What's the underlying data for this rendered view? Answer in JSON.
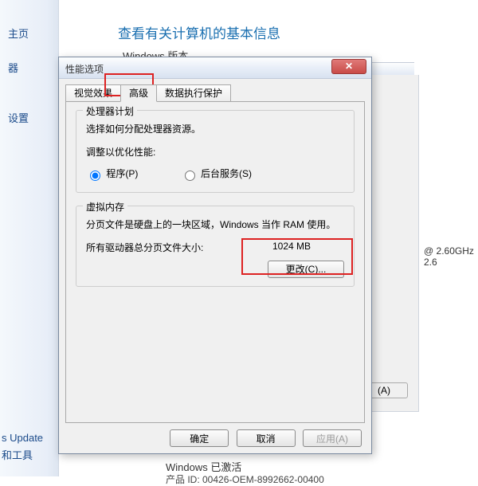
{
  "sidebar": {
    "items": [
      "主页",
      "器",
      "设置"
    ],
    "bottom_links": [
      "s Update",
      "和工具"
    ]
  },
  "bg": {
    "heading": "查看有关计算机的基本信息",
    "sub": "Windows 版本",
    "cpu": "@ 2.60GHz  2.6",
    "btnA": "(A)",
    "activation": "Windows 已激活",
    "oem": "产品 ID: 00426-OEM-8992662-00400"
  },
  "dialog": {
    "title": "性能选项",
    "tabs": {
      "visual": "视觉效果",
      "advanced": "高级",
      "dep": "数据执行保护"
    },
    "proc": {
      "legend": "处理器计划",
      "desc": "选择如何分配处理器资源。",
      "adjust_label": "调整以优化性能:",
      "radio_program": "程序(P)",
      "radio_bg": "后台服务(S)"
    },
    "vm": {
      "legend": "虚拟内存",
      "desc": "分页文件是硬盘上的一块区域，Windows 当作 RAM 使用。",
      "total_label": "所有驱动器总分页文件大小:",
      "total_value": "1024 MB",
      "change_btn": "更改(C)..."
    },
    "buttons": {
      "ok": "确定",
      "cancel": "取消",
      "apply": "应用(A)"
    }
  }
}
